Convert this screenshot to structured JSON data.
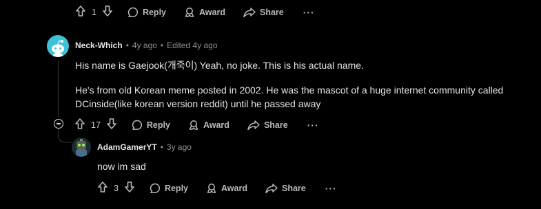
{
  "top_actions": {
    "upvote_count": "1",
    "reply_label": "Reply",
    "award_label": "Award",
    "share_label": "Share",
    "more_label": "···"
  },
  "comment1": {
    "username": "Neck-Which",
    "sep1": "•",
    "age": "4y ago",
    "sep2": "•",
    "edited": "Edited 4y ago",
    "paragraph1": "His name is Gaejook(개죽이) Yeah, no joke. This is his actual name.",
    "paragraph2": "He's from old Korean meme posted in 2002. He was the mascot of a huge internet community called DCinside(like korean version reddit) until he passed away",
    "actions": {
      "upvote_count": "17",
      "reply_label": "Reply",
      "award_label": "Award",
      "share_label": "Share",
      "more_label": "···"
    }
  },
  "comment2": {
    "username": "AdamGamerYT",
    "sep1": "•",
    "age": "3y ago",
    "body": "now im sad",
    "actions": {
      "upvote_count": "3",
      "reply_label": "Reply",
      "award_label": "Award",
      "share_label": "Share",
      "more_label": "···"
    }
  },
  "colors": {
    "background": "#000000",
    "avatar1": "#3fc1d8",
    "thread_line": "#343536"
  }
}
